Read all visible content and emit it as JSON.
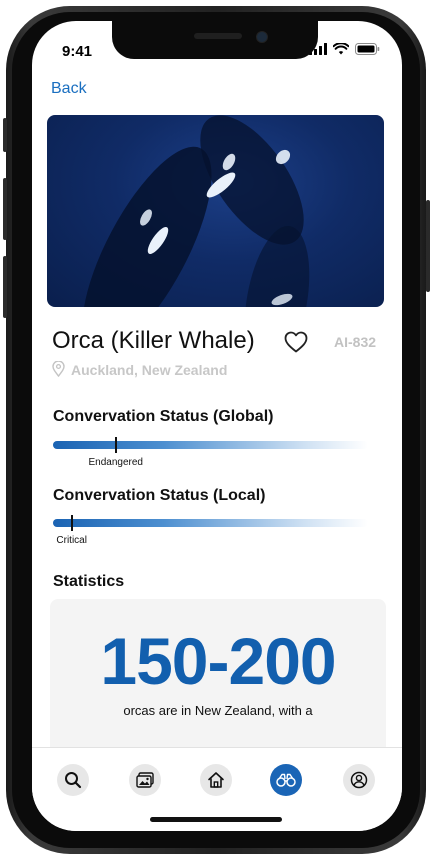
{
  "status_bar": {
    "time": "9:41"
  },
  "header": {
    "back_label": "Back"
  },
  "species": {
    "name": "Orca (Killer Whale)",
    "code": "AI-832",
    "location": "Auckland, New Zealand"
  },
  "conservation": {
    "global": {
      "title": "Convervation Status (Global)",
      "status": "Endangered",
      "level": 0.2
    },
    "local": {
      "title": "Convervation Status (Local)",
      "status": "Critical",
      "level": 0.06
    }
  },
  "statistics": {
    "title": "Statistics",
    "headline": "150-200",
    "description": "orcas are in New Zealand, with a"
  },
  "nav": {
    "items": [
      {
        "icon": "search-icon",
        "active": false
      },
      {
        "icon": "gallery-icon",
        "active": false
      },
      {
        "icon": "home-icon",
        "active": false
      },
      {
        "icon": "binoculars-icon",
        "active": true
      },
      {
        "icon": "profile-icon",
        "active": false
      }
    ]
  },
  "colors": {
    "accent": "#1a65b6",
    "link": "#1a6fc0"
  }
}
